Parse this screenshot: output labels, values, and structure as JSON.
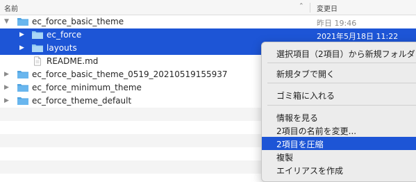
{
  "header": {
    "name_label": "名前",
    "date_label": "変更日",
    "sort_icon": "chevron-up-icon"
  },
  "rows": [
    {
      "name": "ec_force_basic_theme",
      "date": "昨日 19:46",
      "icon": "folder-icon",
      "expand": "expanded"
    },
    {
      "name": "ec_force",
      "date": "2021年5月18日 11:22",
      "icon": "folder-icon",
      "expand": "collapsed"
    },
    {
      "name": "layouts",
      "date": "",
      "icon": "folder-icon",
      "expand": "collapsed"
    },
    {
      "name": "README.md",
      "date": "",
      "icon": "document-icon",
      "expand": ""
    },
    {
      "name": "ec_force_basic_theme_0519_20210519155937",
      "date": "",
      "icon": "folder-icon",
      "expand": "collapsed"
    },
    {
      "name": "ec_force_minimum_theme",
      "date": "",
      "icon": "folder-icon",
      "expand": "collapsed"
    },
    {
      "name": "ec_force_theme_default",
      "date": "",
      "icon": "folder-icon",
      "expand": "collapsed"
    }
  ],
  "context_menu": {
    "items": [
      "選択項目（2項目）から新規フォルダ",
      "新規タブで開く",
      "ゴミ箱に入れる",
      "情報を見る",
      "2項目の名前を変更...",
      "2項目を圧縮",
      "複製",
      "エイリアスを作成"
    ],
    "highlighted": "2項目を圧縮"
  },
  "colors": {
    "selection": "#1d55d6",
    "folder": "#4fa3e0",
    "menu_bg": "#ececec",
    "stripe": "#f4f4f4"
  }
}
